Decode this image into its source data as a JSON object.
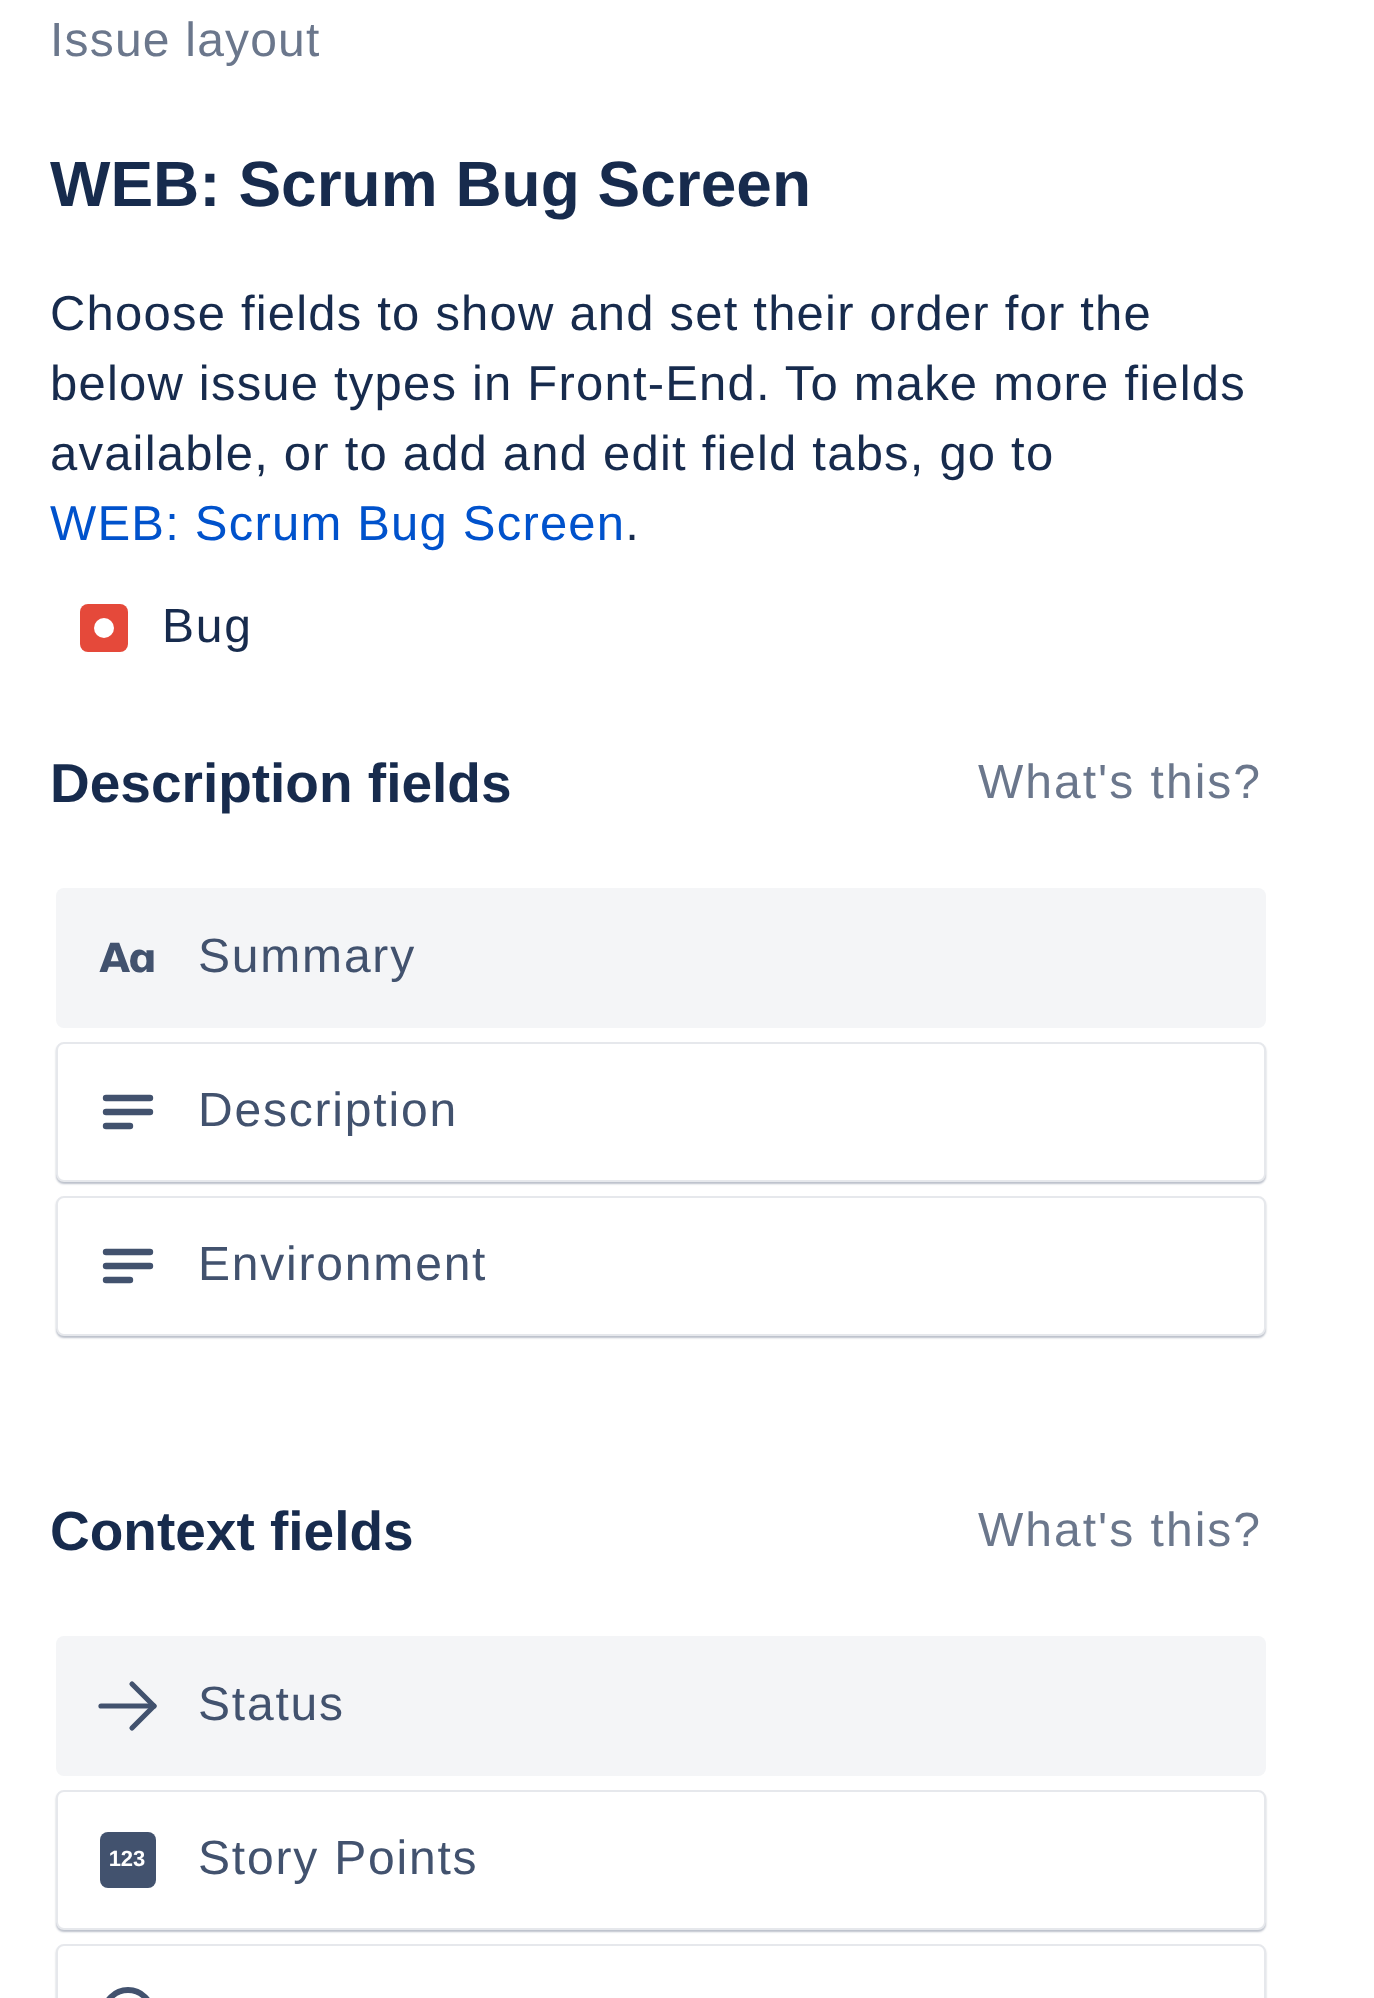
{
  "breadcrumb": "Issue layout",
  "title": "WEB: Scrum Bug Screen",
  "intro": {
    "text": "Choose fields to show and set their order for the below issue types in Front-End. To make more fields available, or to add and edit field tabs, go to",
    "link": "WEB: Scrum Bug Screen",
    "end": "."
  },
  "issue_types": [
    {
      "kind": "bug",
      "label": "Bug"
    }
  ],
  "sections": [
    {
      "title": "Description fields",
      "help": "What's this?",
      "fields": [
        {
          "kind": "text",
          "icon_text": "Aɑ",
          "label": "Summary",
          "locked": true
        },
        {
          "kind": "paragraph",
          "label": "Description",
          "locked": false
        },
        {
          "kind": "paragraph",
          "label": "Environment",
          "locked": false
        }
      ]
    },
    {
      "title": "Context fields",
      "help": "What's this?",
      "fields": [
        {
          "kind": "status",
          "label": "Status",
          "locked": true
        },
        {
          "kind": "number",
          "icon_text": "123",
          "label": "Story Points",
          "locked": false
        },
        {
          "kind": "circle",
          "locked": false
        }
      ]
    }
  ]
}
